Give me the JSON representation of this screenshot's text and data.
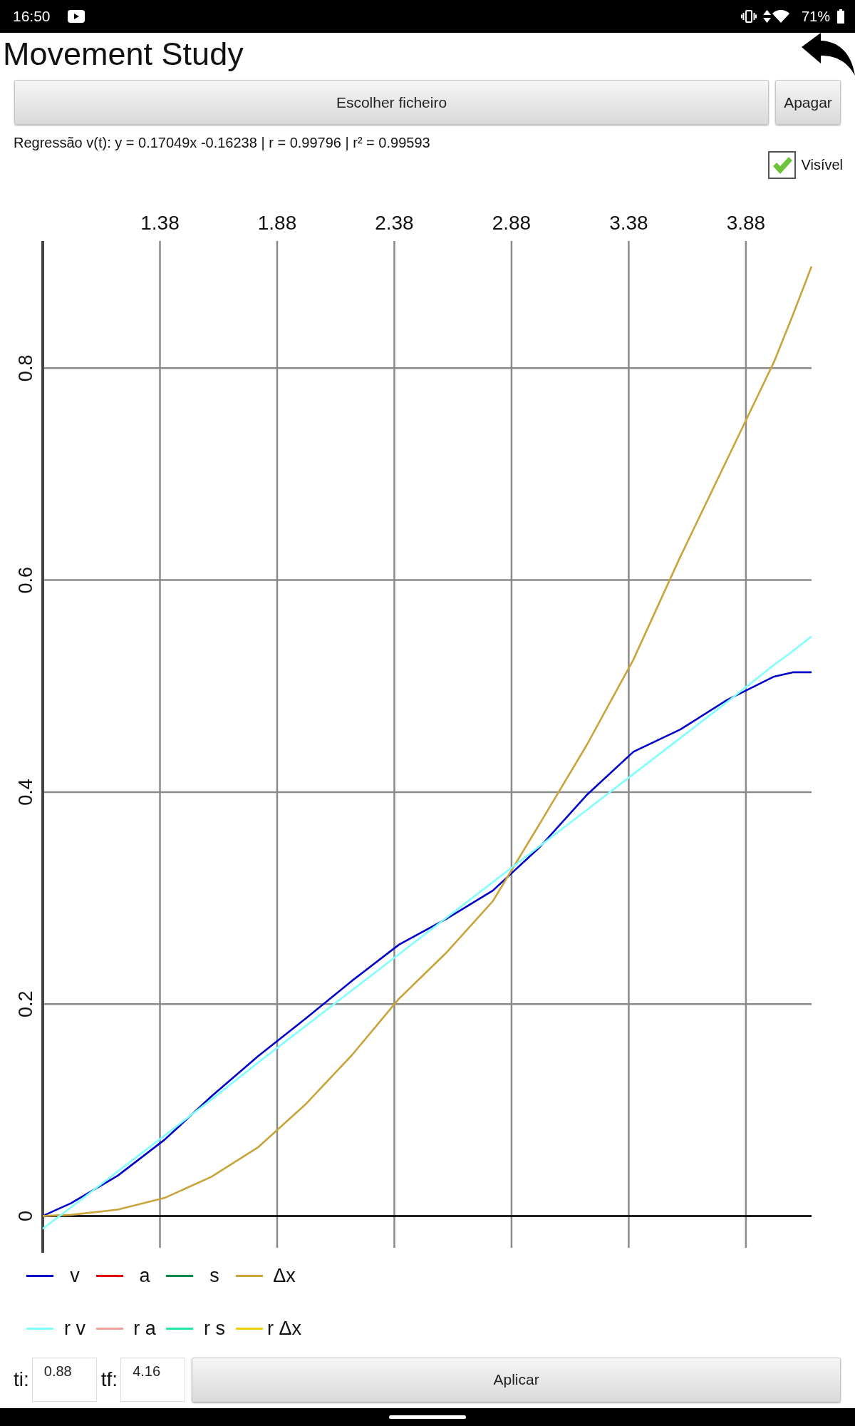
{
  "status_bar": {
    "time": "16:50",
    "battery": "71%"
  },
  "app_bar": {
    "title": "Movement Study"
  },
  "toolbar": {
    "buttons": [
      {
        "label": "Escolher ficheiro"
      },
      {
        "label": "Apagar"
      }
    ]
  },
  "regression": {
    "text": "Regressão v(t): y = 0.17049x -0.16238 | r = 0.99796 | r² = 0.99593"
  },
  "visible_toggle": {
    "label": "Visível",
    "checked": true
  },
  "chart": {
    "chart_data": {
      "type": "line",
      "grid": true,
      "legend": "bottom",
      "x": [
        0.88,
        1.0,
        1.2,
        1.4,
        1.6,
        1.8,
        2.0,
        2.2,
        2.4,
        2.6,
        2.8,
        3.0,
        3.2,
        3.4,
        3.6,
        3.8,
        4.0,
        4.08,
        4.16
      ],
      "series": [
        {
          "name": "v",
          "color": "#0000c8",
          "values": [
            0,
            0.012,
            0.038,
            0.072,
            0.113,
            0.151,
            0.186,
            0.222,
            0.256,
            0.28,
            0.307,
            0.348,
            0.397,
            0.438,
            0.459,
            0.487,
            0.509,
            0.513,
            0.513
          ]
        },
        {
          "name": "a",
          "color": "#e00000",
          "values": [
            null,
            null,
            null,
            null,
            null,
            null,
            null,
            null,
            null,
            null,
            null,
            null,
            null,
            null,
            null,
            null,
            null,
            null,
            null
          ]
        },
        {
          "name": "s",
          "color": "#00884a",
          "values": [
            null,
            null,
            null,
            null,
            null,
            null,
            null,
            null,
            null,
            null,
            null,
            null,
            null,
            null,
            null,
            null,
            null,
            null,
            null
          ]
        },
        {
          "name": "Δx",
          "color": "#c8a43c",
          "values": [
            0,
            0.001,
            0.006,
            0.017,
            0.037,
            0.065,
            0.105,
            0.152,
            0.205,
            0.248,
            0.297,
            0.37,
            0.444,
            0.525,
            0.622,
            0.714,
            0.806,
            0.85,
            0.896
          ]
        },
        {
          "name": "r v",
          "color": "#80ffff",
          "values": [
            -0.012,
            0.008,
            0.042,
            0.076,
            0.11,
            0.145,
            0.179,
            0.213,
            0.247,
            0.281,
            0.315,
            0.349,
            0.383,
            0.417,
            0.451,
            0.485,
            0.52,
            0.533,
            0.547
          ]
        },
        {
          "name": "r a",
          "color": "#f4a09a",
          "values": [
            null,
            null,
            null,
            null,
            null,
            null,
            null,
            null,
            null,
            null,
            null,
            null,
            null,
            null,
            null,
            null,
            null,
            null,
            null
          ]
        },
        {
          "name": "r s",
          "color": "#20e8a0",
          "values": [
            null,
            null,
            null,
            null,
            null,
            null,
            null,
            null,
            null,
            null,
            null,
            null,
            null,
            null,
            null,
            null,
            null,
            null,
            null
          ]
        },
        {
          "name": "r Δx",
          "color": "#f0d000",
          "values": [
            null,
            null,
            null,
            null,
            null,
            null,
            null,
            null,
            null,
            null,
            null,
            null,
            null,
            null,
            null,
            null,
            null,
            null,
            null
          ]
        }
      ],
      "xlim": [
        0.88,
        4.16
      ],
      "ylim": [
        -0.03,
        0.92
      ],
      "xticks": [
        1.38,
        1.88,
        2.38,
        2.88,
        3.38,
        3.88
      ],
      "yticks": [
        0,
        0.2,
        0.4,
        0.6,
        0.8
      ]
    }
  },
  "time_range": {
    "fields": [
      {
        "label": "ti:",
        "value": "0.88"
      },
      {
        "label": "tf:",
        "value": "4.16"
      }
    ],
    "apply_button": "Aplicar"
  }
}
